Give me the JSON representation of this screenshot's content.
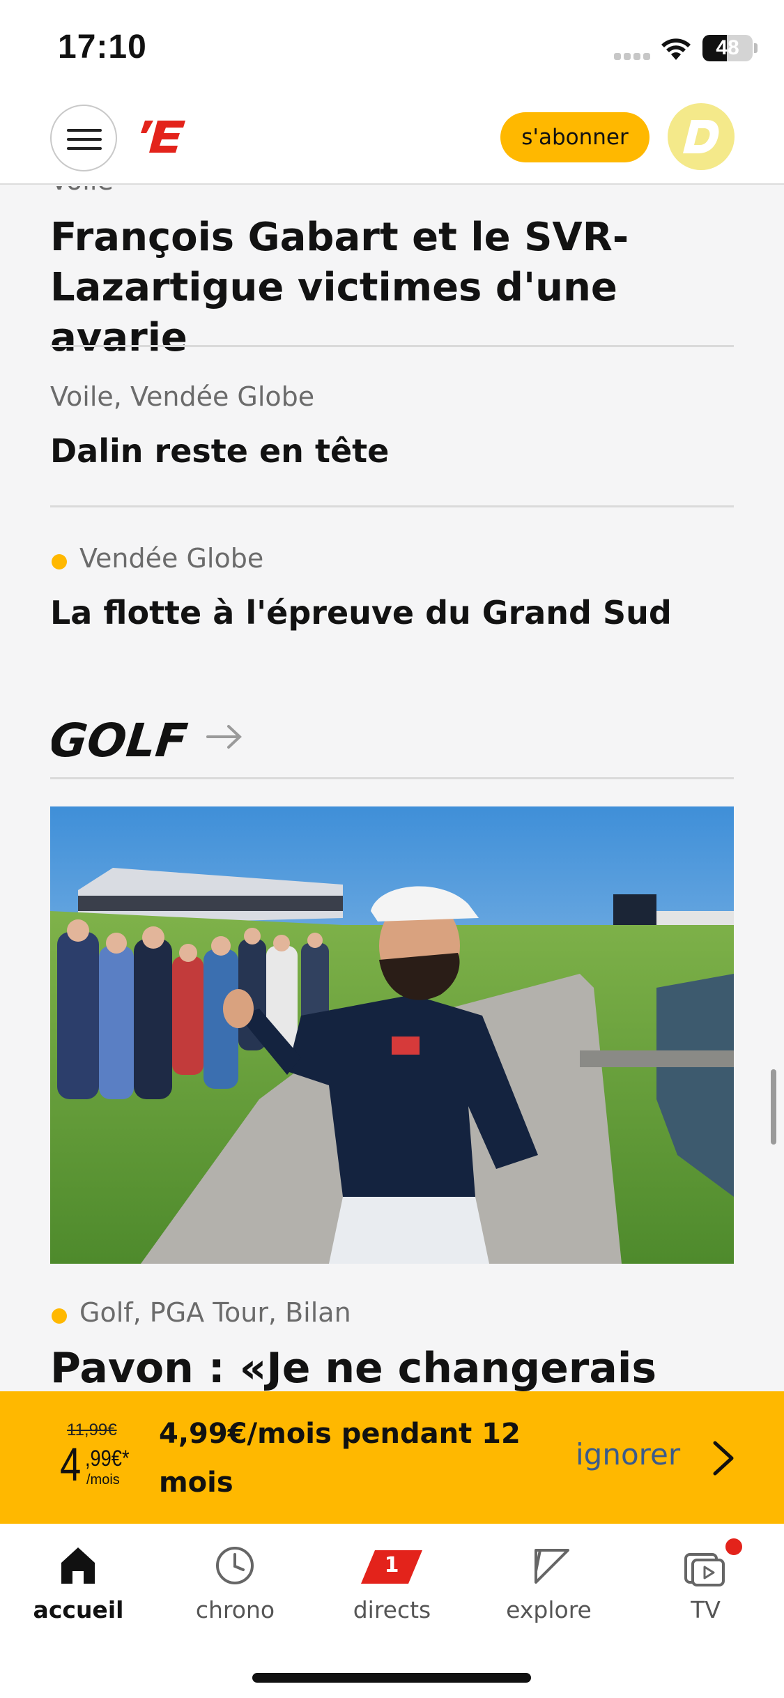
{
  "status_bar": {
    "time": "17:10",
    "battery": "48",
    "battery_level": 0.48
  },
  "header": {
    "logo": "L'E",
    "subscribe_label": "s'abonner",
    "avatar_letter": "D"
  },
  "articles": [
    {
      "tag": "Voile",
      "title": "François Gabart et le SVR-Lazartigue victimes d'une avarie"
    },
    {
      "tag": "Voile, Vendée Globe",
      "title": "Dalin reste en tête"
    },
    {
      "tag": "Vendée Globe",
      "title": "La flotte à l'épreuve du Grand Sud",
      "live": true
    }
  ],
  "section": {
    "title": "GOLF"
  },
  "featured": {
    "tag": "Golf, PGA Tour, Bilan",
    "title": "Pavon : «Je ne changerais"
  },
  "promo": {
    "old_price": "11,99€",
    "new_price_big": "4",
    "new_price_small": ",99€*",
    "per_month": "/mois",
    "text": "4,99€/mois pendant 12 mois",
    "ignore_label": "ignorer"
  },
  "tabs": [
    {
      "label": "accueil",
      "icon": "home-icon",
      "active": true
    },
    {
      "label": "chrono",
      "icon": "clock-icon"
    },
    {
      "label": "directs",
      "icon": "live-badge-icon",
      "badge": "1"
    },
    {
      "label": "explore",
      "icon": "explore-icon"
    },
    {
      "label": "TV",
      "icon": "tv-icon",
      "notification": true
    }
  ],
  "colors": {
    "accent": "#ffb800",
    "brand_red": "#e3231b",
    "link": "#3a5b8c"
  }
}
